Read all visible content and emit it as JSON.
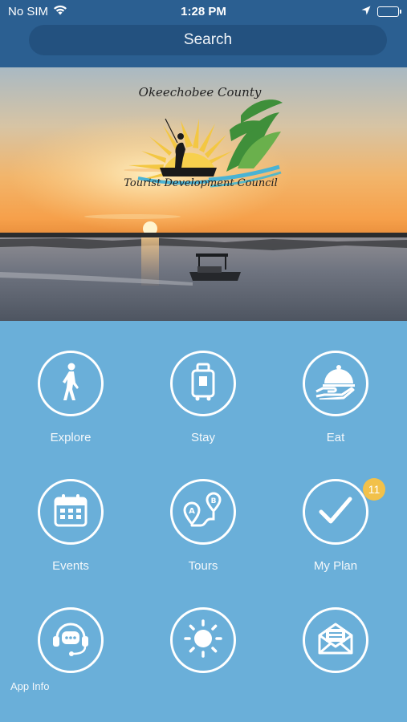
{
  "status_bar": {
    "carrier": "No SIM",
    "time": "1:28 PM"
  },
  "search": {
    "label": "Search"
  },
  "hero": {
    "logo_line1": "Okeechobee County",
    "logo_line2": "Tourist Development Council"
  },
  "tiles": [
    {
      "label": "Explore",
      "icon": "walking-person-icon"
    },
    {
      "label": "Stay",
      "icon": "luggage-icon"
    },
    {
      "label": "Eat",
      "icon": "food-cloche-icon"
    },
    {
      "label": "Events",
      "icon": "calendar-icon"
    },
    {
      "label": "Tours",
      "icon": "route-map-icon"
    },
    {
      "label": "My Plan",
      "icon": "checkmark-icon",
      "badge": "11"
    },
    {
      "label": "",
      "icon": "support-chat-icon"
    },
    {
      "label": "",
      "icon": "sun-icon"
    },
    {
      "label": "",
      "icon": "envelope-icon"
    }
  ],
  "app_info": {
    "label": "App Info"
  },
  "colors": {
    "header": "#2b5f91",
    "search": "#23517f",
    "grid_background": "#6aafd9",
    "badge": "#f2c14a"
  }
}
